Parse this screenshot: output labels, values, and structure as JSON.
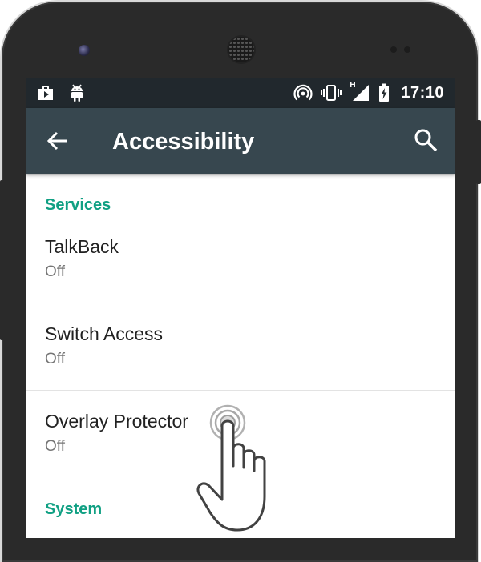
{
  "status_bar": {
    "notification_icons": [
      "play-store-bag-icon",
      "android-icon"
    ],
    "system_icons": [
      "hotspot-icon",
      "vibrate-icon",
      "signal-h-icon",
      "battery-charging-icon"
    ],
    "signal_label": "H",
    "time": "17:10"
  },
  "toolbar": {
    "back_icon": "arrow-back-icon",
    "title": "Accessibility",
    "search_icon": "search-icon",
    "color": "#37474f"
  },
  "sections": [
    {
      "header": "Services",
      "items": [
        {
          "title": "TalkBack",
          "summary": "Off"
        },
        {
          "title": "Switch Access",
          "summary": "Off"
        },
        {
          "title": "Overlay Protector",
          "summary": "Off"
        }
      ]
    },
    {
      "header": "System",
      "items": []
    }
  ],
  "colors": {
    "accent": "#10a083",
    "status_bar": "#21282d",
    "primary_text": "#212121",
    "secondary_text": "#757575"
  },
  "decoration": {
    "pointer_icon": "tap-hand-icon"
  }
}
